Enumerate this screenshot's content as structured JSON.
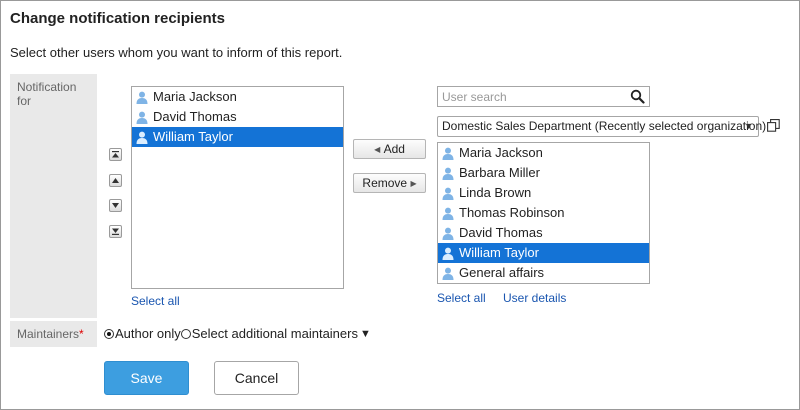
{
  "title": "Change notification recipients",
  "description": "Select other users whom you want to inform of this report.",
  "labels": {
    "notification_for": "Notification for",
    "maintainers": "Maintainers",
    "required_mark": "*"
  },
  "left_list": {
    "items": [
      "Maria Jackson",
      "David Thomas",
      "William Taylor"
    ],
    "selected_index": 2,
    "select_all": "Select all"
  },
  "order_buttons": [
    "move-to-top",
    "move-up",
    "move-down",
    "move-to-bottom"
  ],
  "buttons": {
    "add": "Add",
    "remove": "Remove",
    "save": "Save",
    "cancel": "Cancel"
  },
  "search": {
    "placeholder": "User search",
    "value": ""
  },
  "org_select": {
    "selected": "Domestic Sales Department (Recently selected organization)"
  },
  "right_list": {
    "items": [
      "Maria Jackson",
      "Barbara Miller",
      "Linda Brown",
      "Thomas Robinson",
      "David Thomas",
      "William Taylor",
      "General affairs"
    ],
    "selected_index": 5,
    "select_all": "Select all",
    "user_details": "User details"
  },
  "maintainers": {
    "option1": "Author only",
    "option2": "Select additional maintainers",
    "selected": "option1",
    "dropdown_glyph": "▼"
  },
  "colors": {
    "selection": "#1473d6",
    "save_button": "#3d9ee0",
    "link": "#1a56b0",
    "label_bg": "#e9e9e9"
  }
}
